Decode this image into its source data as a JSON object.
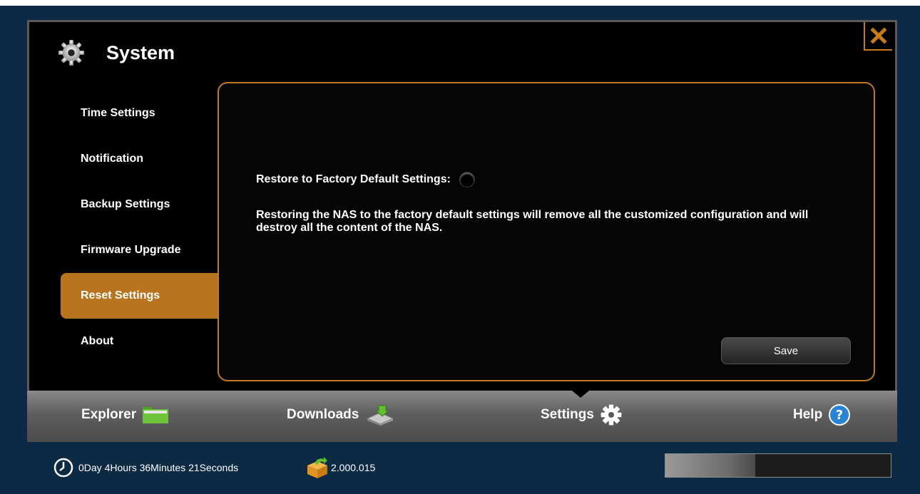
{
  "window": {
    "title": "System",
    "title_icon": "gear-icon",
    "close_icon": "close-icon"
  },
  "sidebar": {
    "items": [
      {
        "label": "Time Settings",
        "active": false
      },
      {
        "label": "Notification",
        "active": false
      },
      {
        "label": "Backup Settings",
        "active": false
      },
      {
        "label": "Firmware Upgrade",
        "active": false
      },
      {
        "label": "Reset Settings",
        "active": true
      },
      {
        "label": "About",
        "active": false
      }
    ]
  },
  "panel": {
    "restore_label": "Restore to Factory Default Settings:",
    "restore_checked": false,
    "description": "Restoring the NAS to the factory default settings will remove all the customized configuration and will destroy all the content of the NAS.",
    "save_label": "Save"
  },
  "tabs": [
    {
      "label": "Explorer",
      "icon": "folder-icon"
    },
    {
      "label": "Downloads",
      "icon": "download-drive-icon"
    },
    {
      "label": "Settings",
      "icon": "gear-icon",
      "active": true
    },
    {
      "label": "Help",
      "icon": "help-icon"
    }
  ],
  "status": {
    "uptime": "0Day 4Hours 36Minutes 21Seconds",
    "uptime_icon": "clock-icon",
    "version": "2.000.015",
    "version_icon": "package-update-icon",
    "progress": 0.4
  },
  "colors": {
    "accent": "#b8741e",
    "panel_border": "#c07a22",
    "background": "#0d2a45",
    "help_blue": "#2a84d6",
    "folder_green": "#6fc43c"
  }
}
